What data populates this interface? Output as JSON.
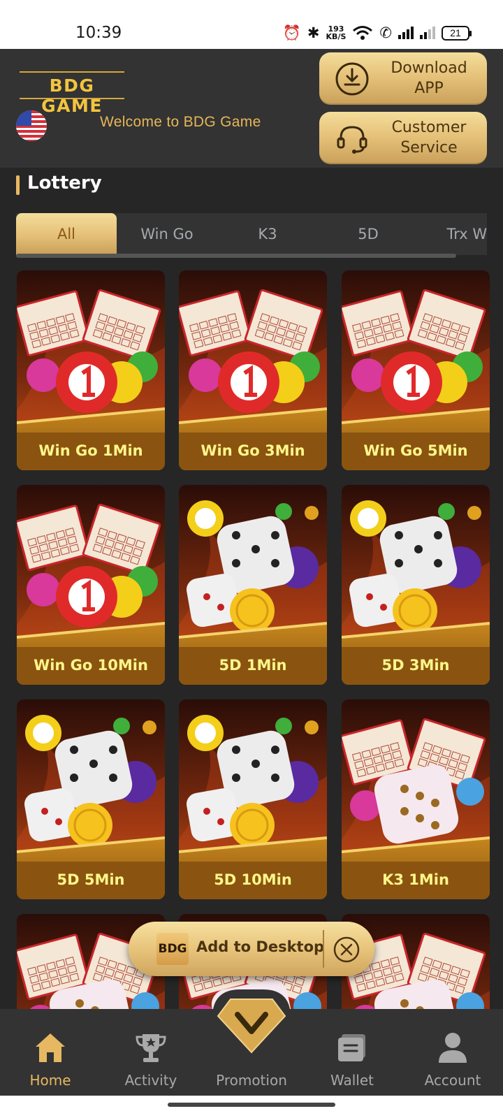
{
  "status_bar": {
    "time": "10:39",
    "speed_value": "193",
    "speed_unit": "KB/S",
    "battery": "21"
  },
  "header": {
    "logo_text": "BDG GAME",
    "welcome": "Welcome to BDG Game",
    "download_label": "Download APP",
    "service_label": "Customer Service",
    "accent": "#e7b862"
  },
  "section": {
    "title": "Lottery"
  },
  "tabs": [
    {
      "label": "All",
      "active": true
    },
    {
      "label": "Win Go",
      "active": false
    },
    {
      "label": "K3",
      "active": false
    },
    {
      "label": "5D",
      "active": false
    },
    {
      "label": "Trx Wi",
      "active": false
    }
  ],
  "games": [
    {
      "label": "Win Go 1Min",
      "art": "wingo"
    },
    {
      "label": "Win Go 3Min",
      "art": "wingo"
    },
    {
      "label": "Win Go 5Min",
      "art": "wingo"
    },
    {
      "label": "Win Go 10Min",
      "art": "wingo"
    },
    {
      "label": "5D 1Min",
      "art": "5d"
    },
    {
      "label": "5D 3Min",
      "art": "5d"
    },
    {
      "label": "5D 5Min",
      "art": "5d"
    },
    {
      "label": "5D 10Min",
      "art": "5d"
    },
    {
      "label": "K3 1Min",
      "art": "k3"
    },
    {
      "label": "",
      "art": "k3"
    },
    {
      "label": "",
      "art": "k3"
    },
    {
      "label": "",
      "art": "k3"
    }
  ],
  "add_to_desktop": {
    "logo": "BDG",
    "label": "Add to Desktop"
  },
  "bottom_nav": [
    {
      "label": "Home",
      "icon": "home-icon",
      "active": true
    },
    {
      "label": "Activity",
      "icon": "trophy-icon",
      "active": false
    },
    {
      "label": "Promotion",
      "icon": "diamond-icon",
      "active": false
    },
    {
      "label": "Wallet",
      "icon": "wallet-icon",
      "active": false
    },
    {
      "label": "Account",
      "icon": "account-icon",
      "active": false
    }
  ]
}
